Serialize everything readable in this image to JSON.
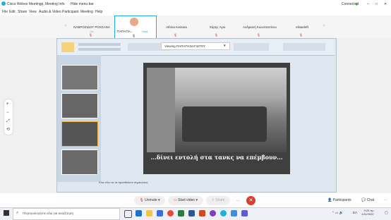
{
  "window": {
    "title": "Cisco Webex Meetings",
    "meeting_info": "Meeting Info",
    "hide_menu_bar": "Hide menu bar",
    "connection_status": "Connected"
  },
  "menu": [
    "File",
    "Edit",
    "Share",
    "View",
    "Audio & Video",
    "Participant",
    "Meeting",
    "Help"
  ],
  "participants": [
    {
      "name": "ΝΑΒΡΟΖΙΔΟΥ ΡΟΧΣΑΝΑ",
      "sub": "Go"
    },
    {
      "name": "ΠΑΠΑΠΑ...",
      "sub": "Host"
    },
    {
      "name": "Athina Kamara",
      "sub": ""
    },
    {
      "name": "Χάρης Αγιο",
      "sub": ""
    },
    {
      "name": "Ανδριανή Κωνσταντίνου",
      "sub": ""
    },
    {
      "name": "elisaeleft",
      "sub": ""
    }
  ],
  "share": {
    "viewing_label": "Viewing ΠΑΠΑΠΑΝΑΓΙΩΤΟΥ",
    "slide_caption": "...δίνει εντολή στα τανκς να επέμβουν...",
    "status_text": "Κλικ εδώ να τα προσθέσετε σημειώσεις"
  },
  "controls": {
    "unmute": "Unmute",
    "start_video": "Start video",
    "share": "Share",
    "participants": "Participants",
    "chat": "Chat"
  },
  "taskbar": {
    "search_placeholder": "Πληκτρολογήστε εδώ για αναζήτηση",
    "lang": "ΕΛ",
    "time": "9:29 πμ",
    "date": "1/11/2020"
  }
}
